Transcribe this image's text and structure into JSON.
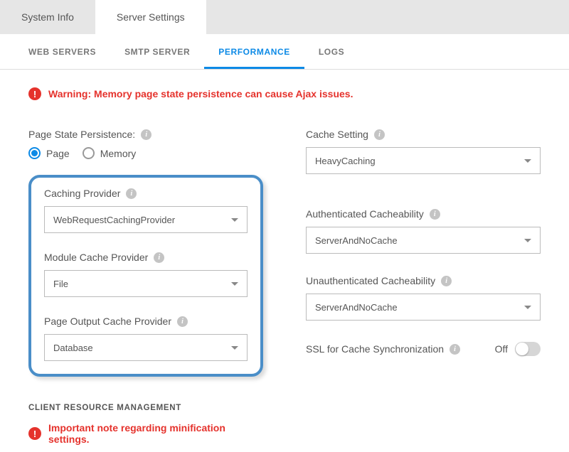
{
  "mainTabs": {
    "systemInfo": "System Info",
    "serverSettings": "Server Settings"
  },
  "subTabs": {
    "webServers": "WEB SERVERS",
    "smtpServer": "SMTP SERVER",
    "performance": "PERFORMANCE",
    "logs": "LOGS"
  },
  "warningTop": "Warning: Memory page state persistence can cause Ajax issues.",
  "pageStatePersistence": {
    "label": "Page State Persistence:",
    "optionPage": "Page",
    "optionMemory": "Memory"
  },
  "cachingProvider": {
    "label": "Caching Provider",
    "value": "WebRequestCachingProvider"
  },
  "moduleCacheProvider": {
    "label": "Module Cache Provider",
    "value": "File"
  },
  "pageOutputCacheProvider": {
    "label": "Page Output Cache Provider",
    "value": "Database"
  },
  "cacheSetting": {
    "label": "Cache Setting",
    "value": "HeavyCaching"
  },
  "authCache": {
    "label": "Authenticated Cacheability",
    "value": "ServerAndNoCache"
  },
  "unauthCache": {
    "label": "Unauthenticated Cacheability",
    "value": "ServerAndNoCache"
  },
  "sslSync": {
    "label": "SSL for Cache Synchronization",
    "state": "Off"
  },
  "clientResourceMgmt": "CLIENT RESOURCE MANAGEMENT",
  "minificationNote": "Important note regarding minification settings."
}
